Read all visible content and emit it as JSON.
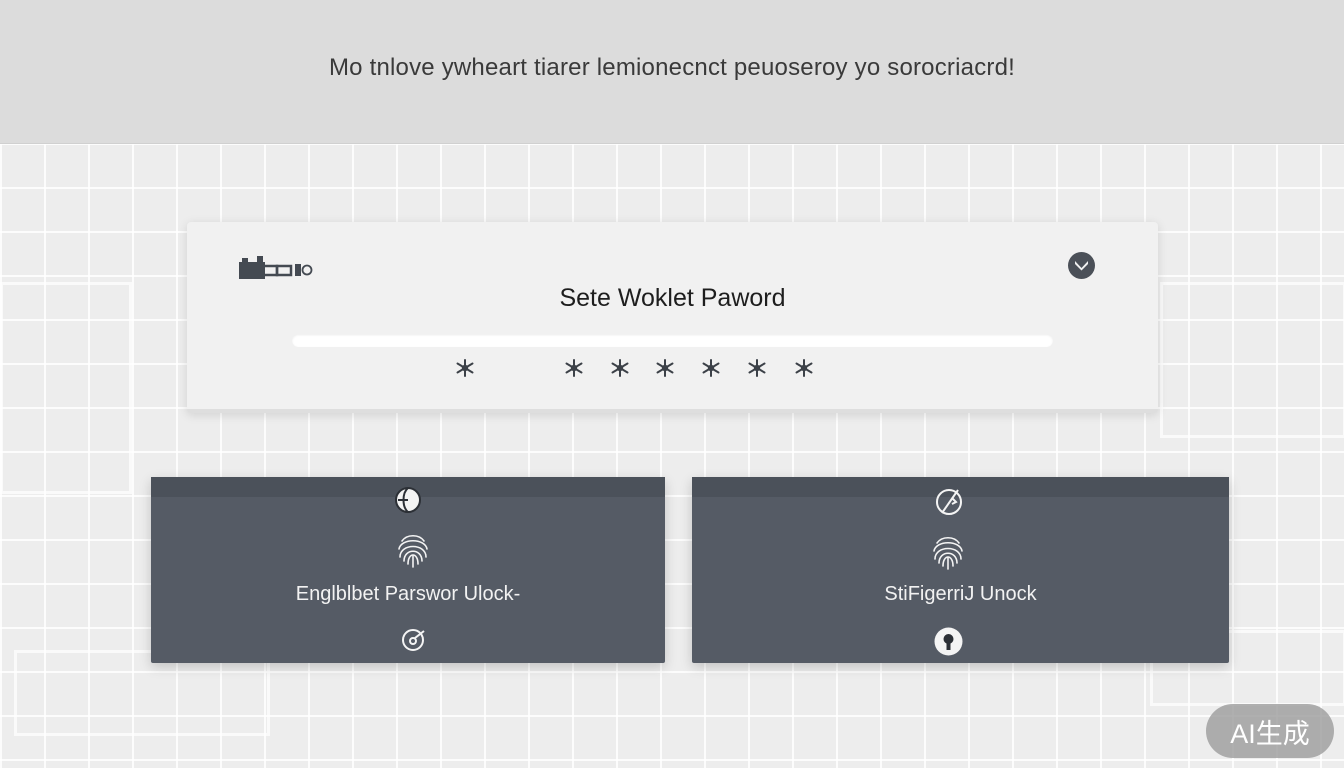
{
  "banner": {
    "text": "Mo tnlove  ywheart tiarer lemionecnct peuoseroy yo sorocriacrd!"
  },
  "password_card": {
    "title": "Sete Woklet Paword",
    "field_value": "",
    "dot_count": 7,
    "icons": {
      "key": "key-icon",
      "close": "close-icon",
      "dot": "asterisk-dot"
    }
  },
  "options": [
    {
      "label": "Englblbet Parswor Ulock-",
      "icons": [
        "globe-icon",
        "fingerprint-icon",
        "eye-icon"
      ]
    },
    {
      "label": "StiFigerriJ Unock",
      "icons": [
        "no-touch-icon",
        "fingerprint-icon",
        "keyhole-icon"
      ]
    }
  ],
  "badge": {
    "text": "AI生成"
  },
  "colors": {
    "banner_bg": "#dcdcdc",
    "card_bg": "#f1f1f1",
    "option_bg": "#555b65",
    "badge_bg": "#969696"
  }
}
